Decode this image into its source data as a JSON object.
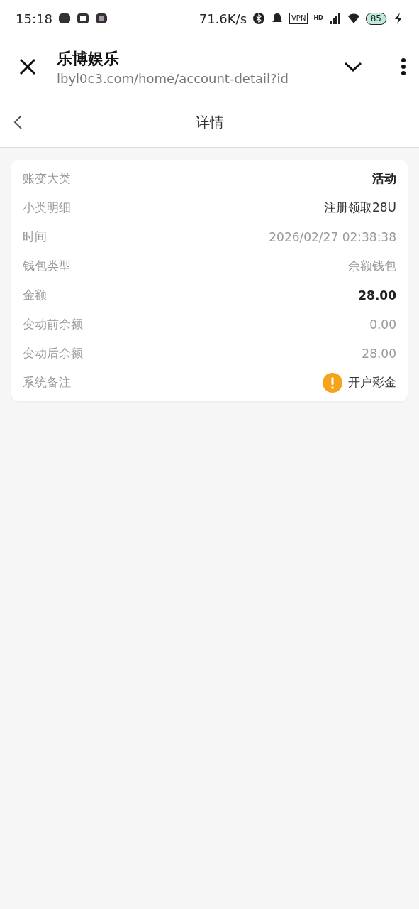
{
  "status_bar": {
    "time": "15:18",
    "speed": "71.6K/s",
    "vpn": "VPN",
    "hd": "HD",
    "battery": "85"
  },
  "browser_bar": {
    "title": "乐博娱乐",
    "url": "lbyl0c3.com/home/account-detail?id"
  },
  "nav": {
    "title": "详情"
  },
  "details": [
    {
      "label": "账变大类",
      "value": "活动",
      "kind": "emphasis"
    },
    {
      "label": "小类明细",
      "value": "注册领取28U",
      "kind": "plain"
    },
    {
      "label": "时间",
      "value": "2026/02/27 02:38:38",
      "kind": "muted"
    },
    {
      "label": "钱包类型",
      "value": "余额钱包",
      "kind": "muted"
    },
    {
      "label": "金额",
      "value": "28.00",
      "kind": "amount"
    },
    {
      "label": "变动前余额",
      "value": "0.00",
      "kind": "muted"
    },
    {
      "label": "变动后余额",
      "value": "28.00",
      "kind": "muted"
    },
    {
      "label": "系统备注",
      "value": "开户彩金",
      "kind": "note"
    }
  ]
}
